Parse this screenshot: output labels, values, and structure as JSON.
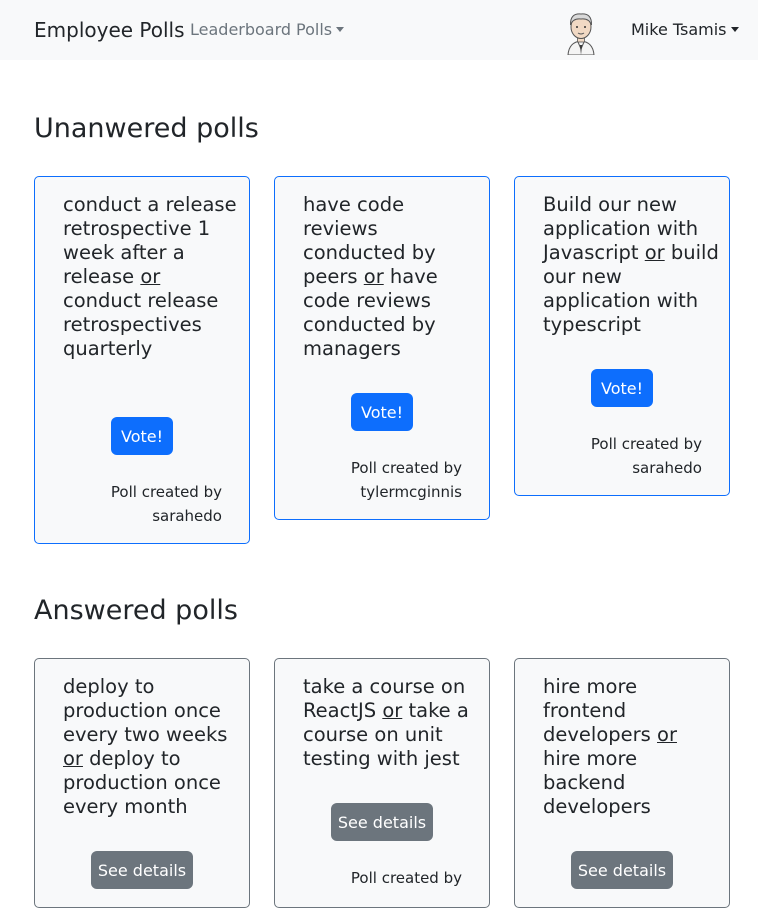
{
  "navbar": {
    "brand": "Employee Polls",
    "leaderboard": "Leaderboard",
    "polls": "Polls",
    "user_name": "Mike Tsamis"
  },
  "unanswered": {
    "title": "Unanwered polls",
    "cards": [
      {
        "option_one": "conduct a release retrospective 1 week after a release",
        "or": "or",
        "option_two": "conduct release retrospectives quarterly",
        "button": "Vote!",
        "created_label": "Poll created by",
        "author": "sarahedo"
      },
      {
        "option_one": "have code reviews conducted by peers",
        "or": "or",
        "option_two": "have code reviews conducted by managers",
        "button": "Vote!",
        "created_label": "Poll created by",
        "author": "tylermcginnis"
      },
      {
        "option_one": "Build our new application with Javascript",
        "or": "or",
        "option_two": "build our new application with typescript",
        "button": "Vote!",
        "created_label": "Poll created by",
        "author": "sarahedo"
      }
    ]
  },
  "answered": {
    "title": "Answered polls",
    "cards": [
      {
        "option_one": "deploy to production once every two weeks",
        "or": "or",
        "option_two": "deploy to production once every month",
        "button": "See details"
      },
      {
        "option_one": "take a course on ReactJS",
        "or": "or",
        "option_two": "take a course on unit testing with jest",
        "button": "See details",
        "created_label": "Poll created by"
      },
      {
        "option_one": "hire more frontend developers",
        "or": "or",
        "option_two": "hire more backend developers",
        "button": "See details"
      }
    ]
  },
  "colors": {
    "primary": "#0d6efd",
    "secondary": "#6c757d",
    "navbar_bg": "#f8f9fa"
  }
}
